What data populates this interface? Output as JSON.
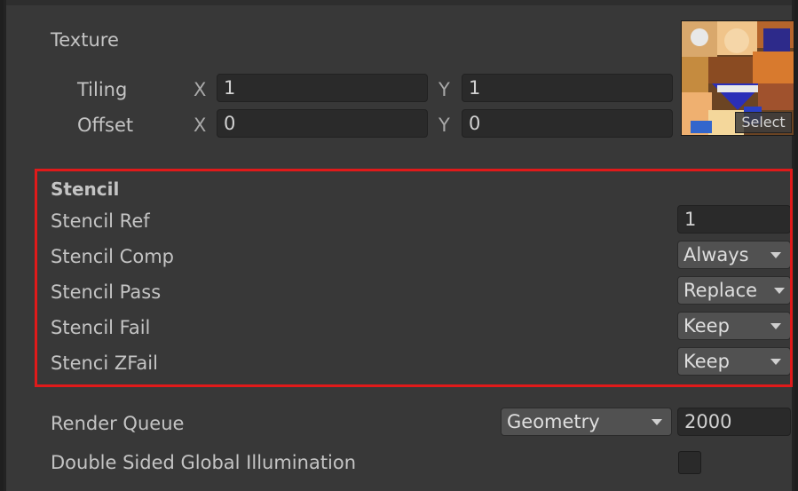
{
  "texture": {
    "label": "Texture",
    "tiling_label": "Tiling",
    "offset_label": "Offset",
    "x_label": "X",
    "y_label": "Y",
    "tiling_x": "1",
    "tiling_y": "1",
    "offset_x": "0",
    "offset_y": "0",
    "select_label": "Select"
  },
  "stencil": {
    "header": "Stencil",
    "ref_label": "Stencil Ref",
    "ref_value": "1",
    "comp_label": "Stencil Comp",
    "comp_value": "Always",
    "pass_label": "Stencil Pass",
    "pass_value": "Replace",
    "fail_label": "Stencil Fail",
    "fail_value": "Keep",
    "zfail_label": "Stenci ZFail",
    "zfail_value": "Keep"
  },
  "render_queue": {
    "label": "Render Queue",
    "mode": "Geometry",
    "value": "2000"
  },
  "double_sided_gi": {
    "label": "Double Sided Global Illumination",
    "checked": false
  },
  "colors": {
    "highlight": "#e01a1a",
    "panel_bg": "#383838"
  }
}
